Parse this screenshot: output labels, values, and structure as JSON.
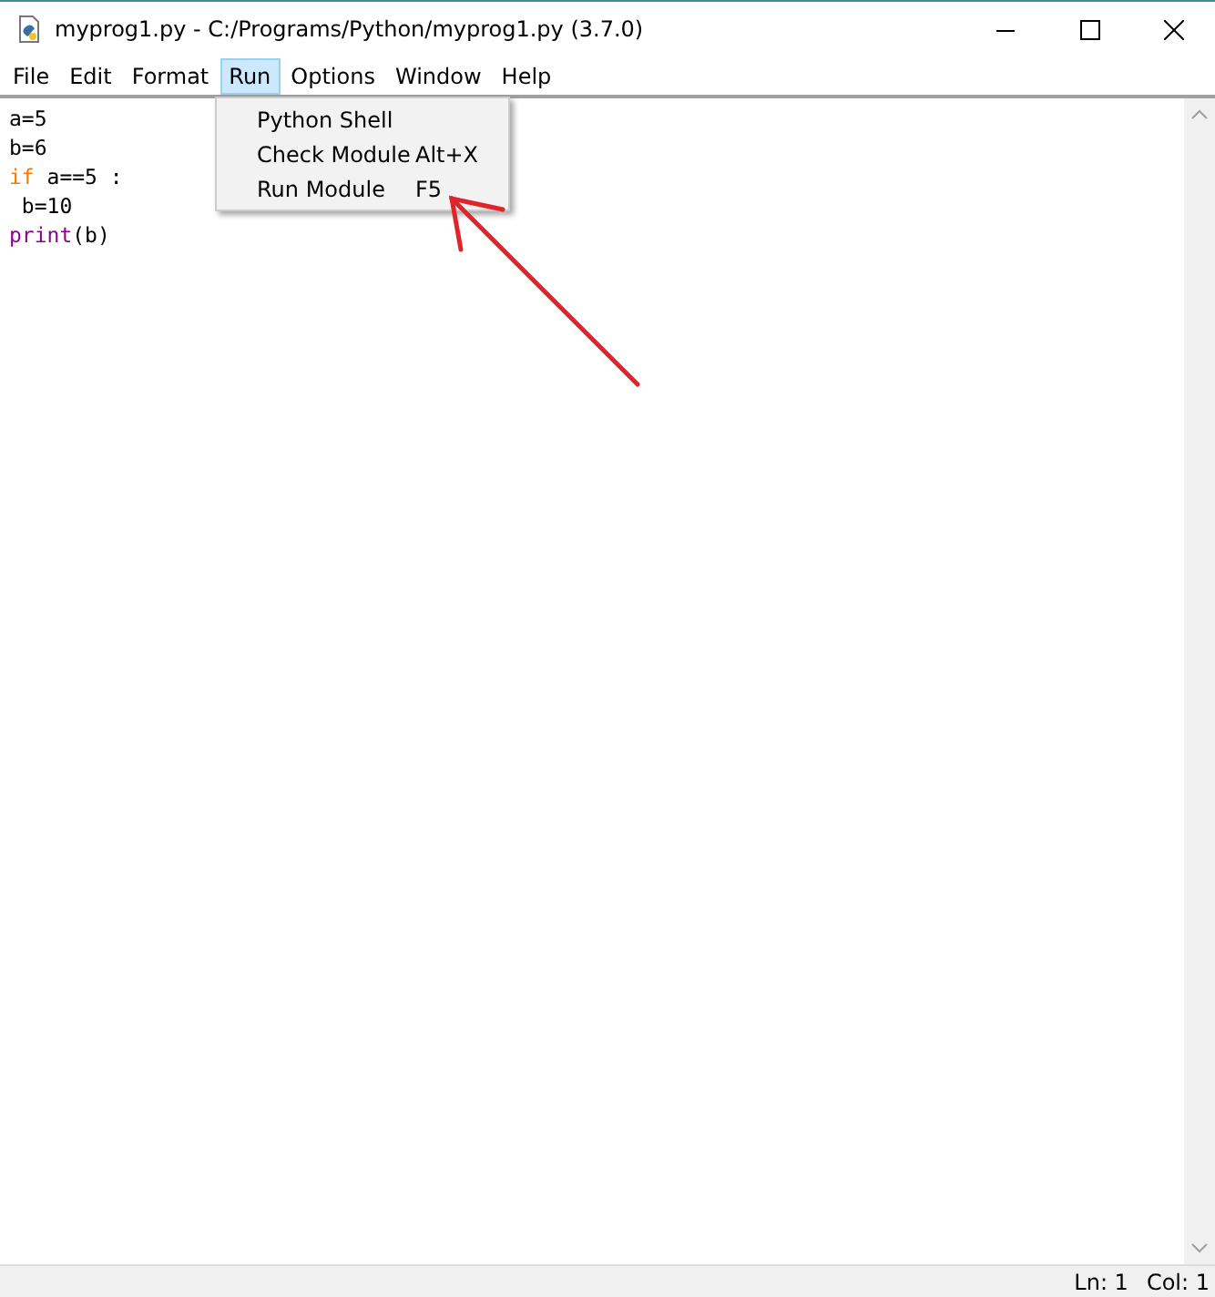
{
  "window": {
    "title": "myprog1.py - C:/Programs/Python/myprog1.py (3.7.0)"
  },
  "menu_bar": [
    {
      "label": "File",
      "selected": false
    },
    {
      "label": "Edit",
      "selected": false
    },
    {
      "label": "Format",
      "selected": false
    },
    {
      "label": "Run",
      "selected": true
    },
    {
      "label": "Options",
      "selected": false
    },
    {
      "label": "Window",
      "selected": false
    },
    {
      "label": "Help",
      "selected": false
    }
  ],
  "run_menu": [
    {
      "label": "Python Shell"
    },
    {
      "label": "Check Module",
      "shortcut": "Alt+X"
    },
    {
      "label": "Run Module",
      "shortcut": "F5"
    }
  ],
  "editor": {
    "lines": [
      [
        {
          "text": "a=5",
          "kind": "plain"
        }
      ],
      [
        {
          "text": "b=6",
          "kind": "plain"
        }
      ],
      [
        {
          "text": "if",
          "kind": "keyword"
        },
        {
          "text": " a==5 :",
          "kind": "plain"
        }
      ],
      [
        {
          "text": " b=10",
          "kind": "plain"
        }
      ],
      [
        {
          "text": "print",
          "kind": "builtin"
        },
        {
          "text": "(b)",
          "kind": "plain"
        }
      ]
    ]
  },
  "status_bar": {
    "line": "Ln: 1",
    "column": "Col: 1"
  }
}
